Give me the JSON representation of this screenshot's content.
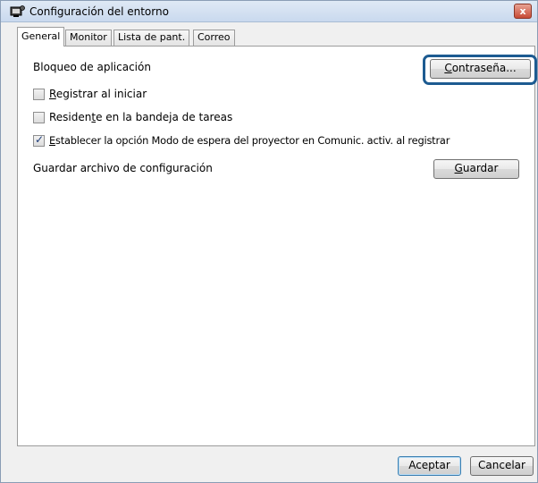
{
  "window": {
    "title": "Configuración del entorno",
    "close_symbol": "x"
  },
  "tabs": [
    {
      "label": "General",
      "active": true
    },
    {
      "label": "Monitor",
      "active": false
    },
    {
      "label": "Lista de pant.",
      "active": false
    },
    {
      "label": "Correo",
      "active": false
    }
  ],
  "general": {
    "app_lock_label": "Bloqueo de aplicación",
    "password_button": {
      "prefix": "",
      "accel": "C",
      "suffix": "ontraseña..."
    },
    "register_on_start": {
      "prefix": "",
      "accel": "R",
      "suffix": "egistrar al iniciar",
      "checked": false
    },
    "tray_resident": {
      "prefix": "Residen",
      "accel": "t",
      "suffix": "e en la bandeja de tareas",
      "checked": false
    },
    "standby_option": {
      "prefix": "",
      "accel": "E",
      "suffix": "stablecer la opción Modo de espera del proyector en Comunic. activ. al registrar",
      "checked": true
    },
    "save_config_label": "Guardar archivo de configuración",
    "save_button": {
      "prefix": "",
      "accel": "G",
      "suffix": "uardar"
    }
  },
  "footer": {
    "ok_label": "Aceptar",
    "cancel_label": "Cancelar"
  },
  "colors": {
    "highlight_ring": "#1d5b91",
    "close_button": "#c74a35"
  },
  "icons": {
    "app": "projector-settings-icon",
    "close": "close-icon"
  }
}
